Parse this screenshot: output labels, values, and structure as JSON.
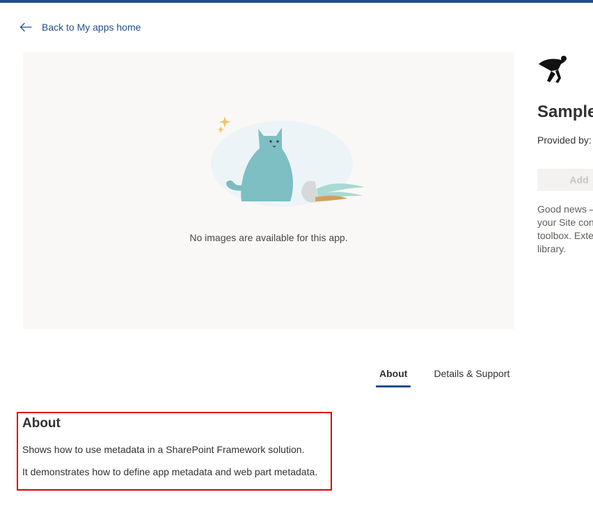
{
  "header": {
    "back_label": "Back to My apps home"
  },
  "gallery": {
    "empty_message": "No images are available for this app."
  },
  "app": {
    "title": "Sample",
    "provided_by_label": "Provided by:",
    "add_button_label": "Add",
    "description_lines": [
      "Good news –",
      "your Site con",
      "toolbox. Exte",
      "library."
    ]
  },
  "tabs": [
    {
      "label": "About",
      "active": true
    },
    {
      "label": "Details & Support",
      "active": false
    }
  ],
  "about": {
    "heading": "About",
    "paragraphs": [
      "Shows how to use metadata in a SharePoint Framework solution.",
      "It demonstrates how to define app metadata and web part metadata."
    ]
  },
  "colors": {
    "accent": "#1f4e8c",
    "highlight_border": "#e00000",
    "gallery_bg": "#faf8f6"
  }
}
